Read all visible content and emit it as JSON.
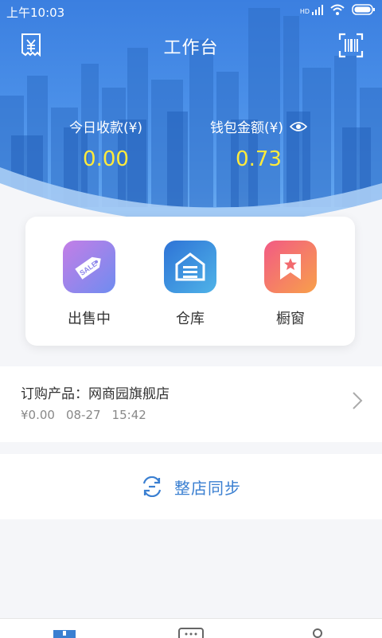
{
  "status_bar": {
    "time": "上午10:03",
    "network": "HD"
  },
  "header": {
    "title": "工作台"
  },
  "stats": {
    "today_label": "今日收款(¥)",
    "today_value": "0.00",
    "wallet_label": "钱包金额(¥)",
    "wallet_value": "0.73"
  },
  "shortcuts": [
    {
      "label": "出售中",
      "badge": "SALE"
    },
    {
      "label": "仓库"
    },
    {
      "label": "橱窗"
    }
  ],
  "order": {
    "title": "订购产品：网商园旗舰店",
    "price": "¥0.00",
    "date": "08-27",
    "time": "15:42"
  },
  "sync": {
    "label": "整店同步"
  },
  "colors": {
    "accent": "#3a7fd1",
    "hero": "#4a8fe8",
    "value_yellow": "#ffeb3b"
  }
}
